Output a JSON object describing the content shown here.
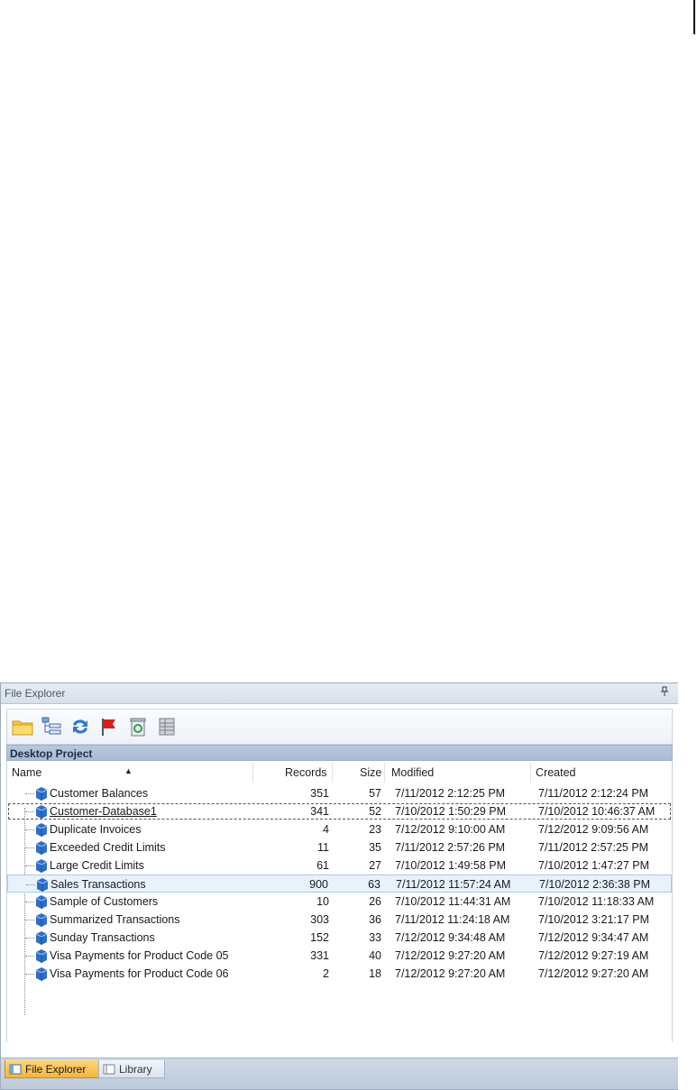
{
  "panel": {
    "title": "File Explorer",
    "pin_glyph": "ᵖ"
  },
  "toolbar": {
    "buttons": [
      {
        "icon": "folder-icon"
      },
      {
        "icon": "tree-view-icon"
      },
      {
        "icon": "refresh-icon"
      },
      {
        "icon": "flag-icon"
      },
      {
        "icon": "recycle-bin-icon"
      },
      {
        "icon": "table-view-icon"
      }
    ]
  },
  "project": {
    "label": "Desktop Project"
  },
  "columns": {
    "name": "Name",
    "records": "Records",
    "size": "Size",
    "modified": "Modified",
    "created": "Created"
  },
  "rows": [
    {
      "name": "Customer Balances",
      "records": "351",
      "size": "57",
      "modified": "7/11/2012 2:12:25 PM",
      "created": "7/11/2012 2:12:24 PM"
    },
    {
      "name": "Customer-Database1",
      "records": "341",
      "size": "52",
      "modified": "7/10/2012 1:50:29 PM",
      "created": "7/10/2012 10:46:37 AM"
    },
    {
      "name": "Duplicate Invoices",
      "records": "4",
      "size": "23",
      "modified": "7/12/2012 9:10:00 AM",
      "created": "7/12/2012 9:09:56 AM"
    },
    {
      "name": "Exceeded Credit Limits",
      "records": "11",
      "size": "35",
      "modified": "7/11/2012 2:57:26 PM",
      "created": "7/11/2012 2:57:25 PM"
    },
    {
      "name": "Large Credit Limits",
      "records": "61",
      "size": "27",
      "modified": "7/10/2012 1:49:58 PM",
      "created": "7/10/2012 1:47:27 PM"
    },
    {
      "name": "Sales Transactions",
      "records": "900",
      "size": "63",
      "modified": "7/11/2012 11:57:24 AM",
      "created": "7/10/2012 2:36:38 PM"
    },
    {
      "name": "Sample of Customers",
      "records": "10",
      "size": "26",
      "modified": "7/10/2012 11:44:31 AM",
      "created": "7/10/2012 11:18:33 AM"
    },
    {
      "name": "Summarized Transactions",
      "records": "303",
      "size": "36",
      "modified": "7/11/2012 11:24:18 AM",
      "created": "7/10/2012 3:21:17 PM"
    },
    {
      "name": "Sunday Transactions",
      "records": "152",
      "size": "33",
      "modified": "7/12/2012 9:34:48 AM",
      "created": "7/12/2012 9:34:47 AM"
    },
    {
      "name": "Visa Payments for Product Code 05",
      "records": "331",
      "size": "40",
      "modified": "7/12/2012 9:27:20 AM",
      "created": "7/12/2012 9:27:19 AM"
    },
    {
      "name": "Visa Payments for Product Code 06",
      "records": "2",
      "size": "18",
      "modified": "7/12/2012 9:27:20 AM",
      "created": "7/12/2012 9:27:20 AM"
    }
  ],
  "tabs": {
    "file_explorer": "File Explorer",
    "library": "Library"
  },
  "colors": {
    "selection": "#e8f2fc",
    "active_tab": "#f4b63c",
    "header": "#b9c9de"
  }
}
